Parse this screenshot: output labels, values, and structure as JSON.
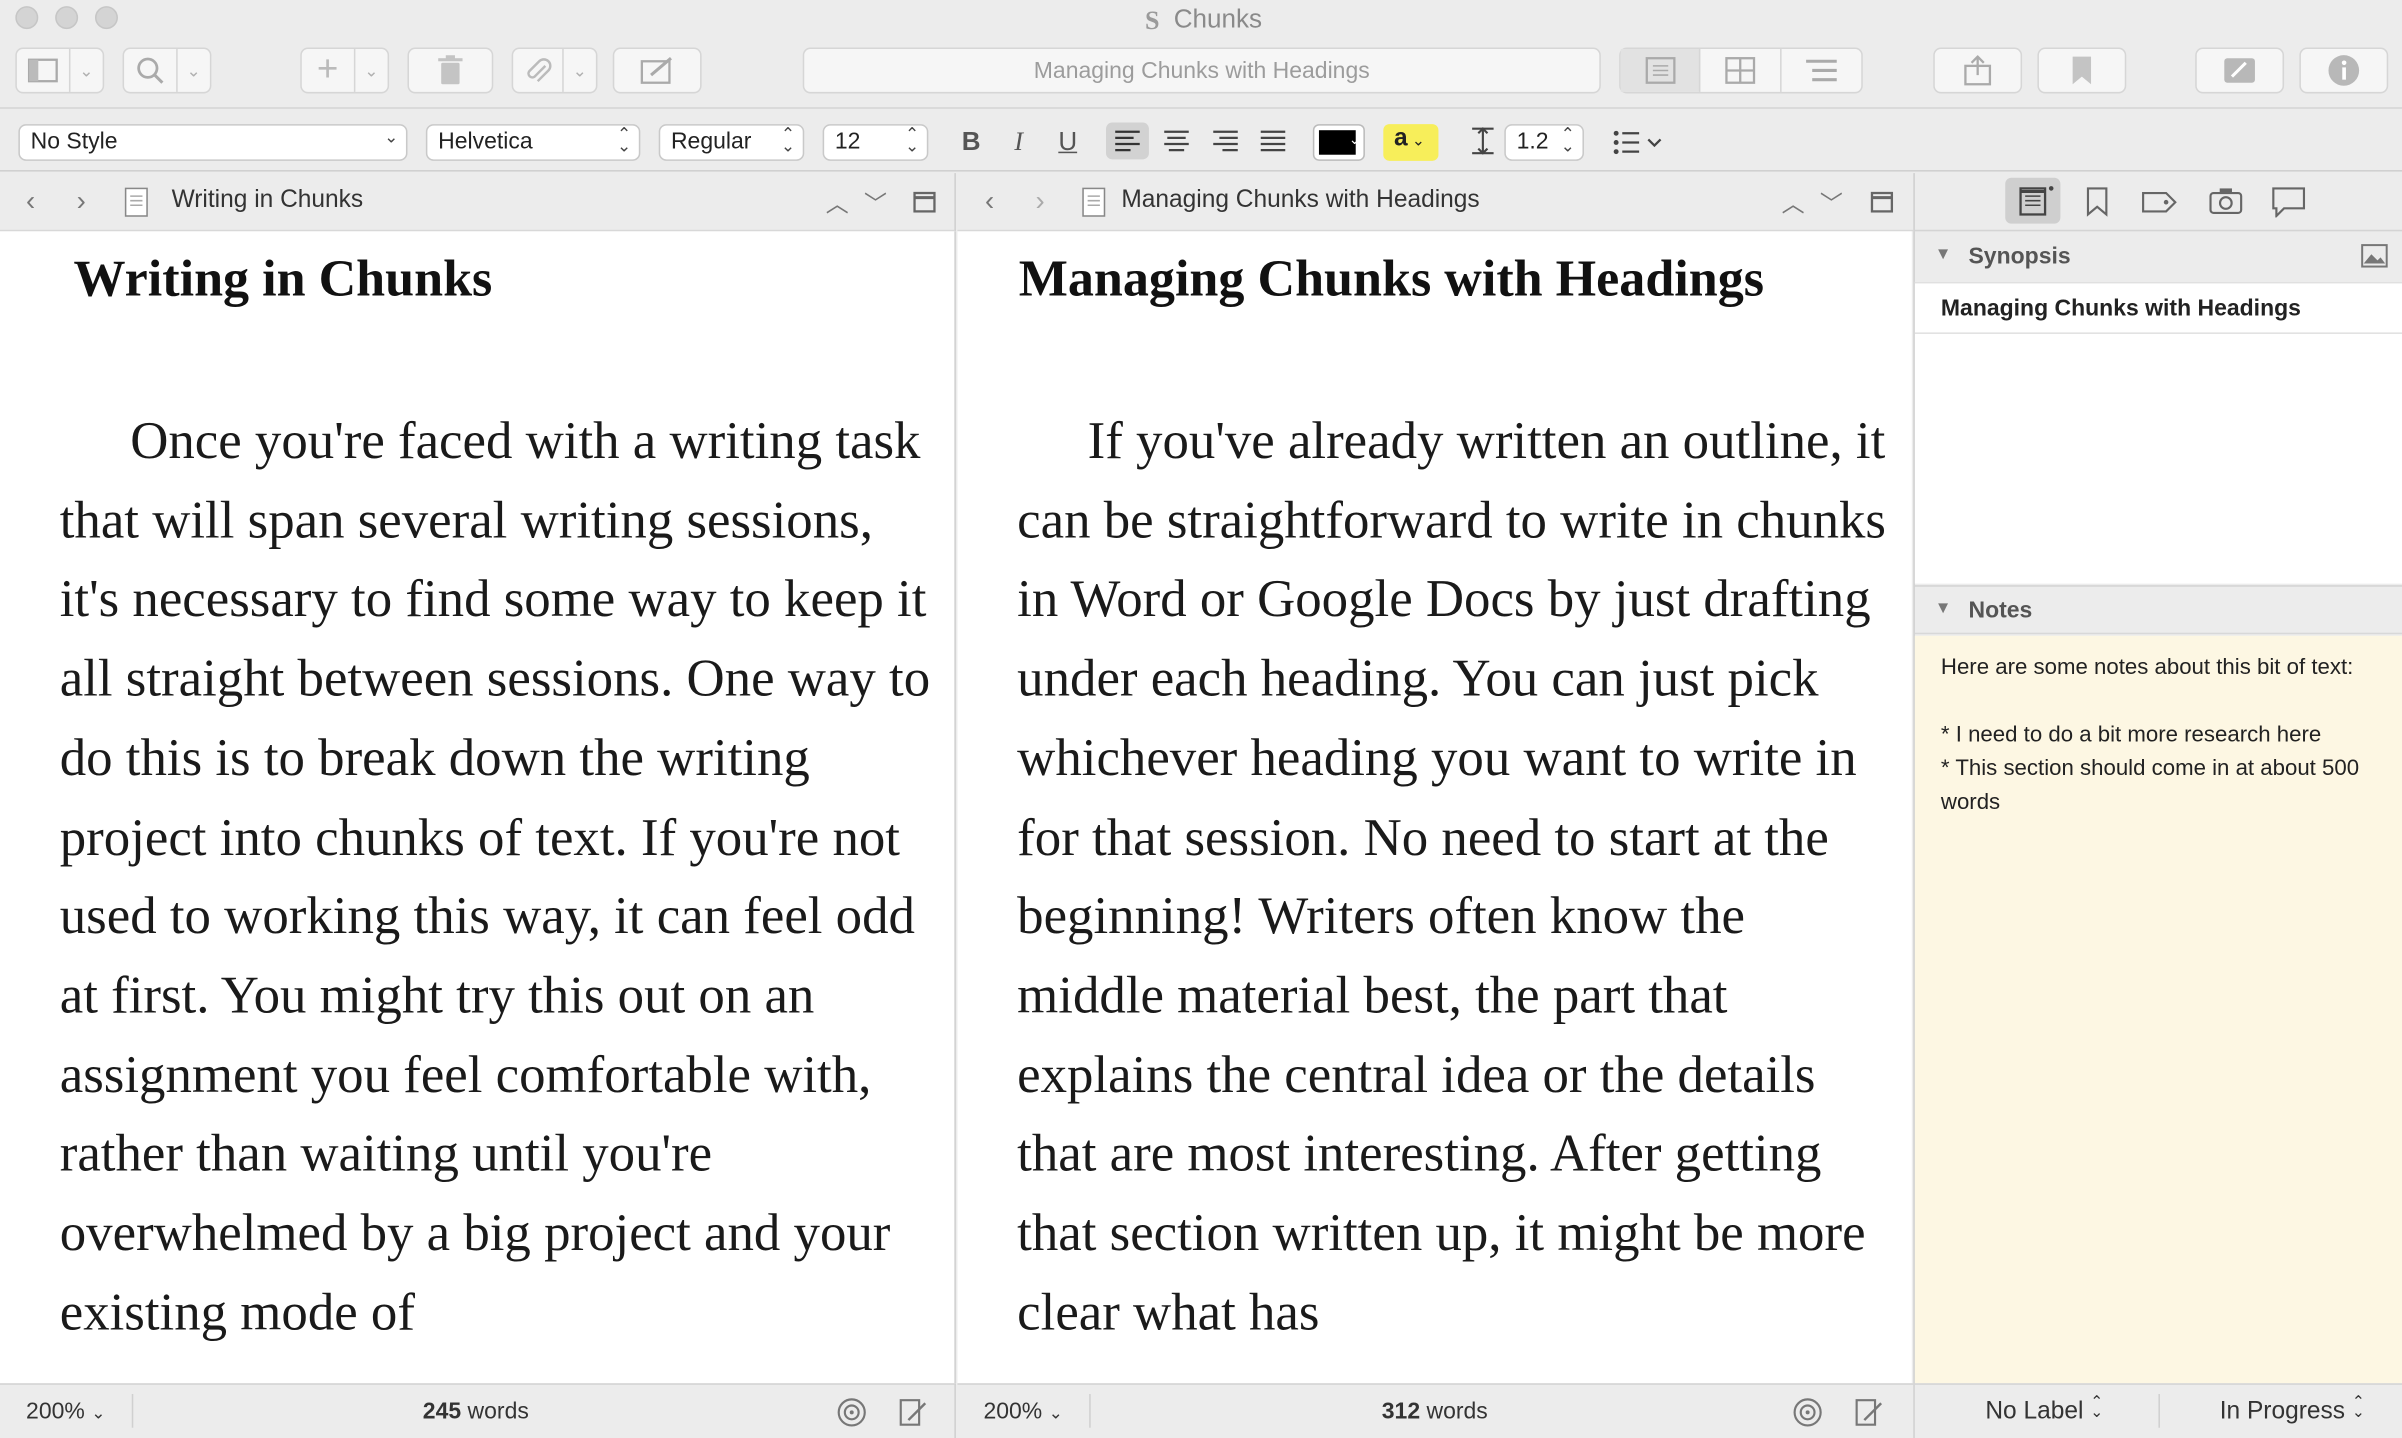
{
  "window": {
    "title": "Chunks"
  },
  "toolbar": {
    "document_title": "Managing Chunks with Headings"
  },
  "format_bar": {
    "paragraph_style": "No Style",
    "font_family": "Helvetica",
    "font_weight": "Regular",
    "font_size": "12",
    "bold": "B",
    "italic": "I",
    "underline": "U",
    "highlight_letter": "a",
    "line_spacing": "1.2",
    "text_color": "#000000",
    "highlight_color": "#f7ee5a"
  },
  "left_editor": {
    "header_title": "Writing in Chunks",
    "heading": "Writing in Chunks",
    "body": "Once you're faced with a writing task that will span several writing sessions, it's necessary to find some way to keep it all straight between sessions. One way to do this is to break down the writing project into chunks of text. If you're not used to working this way, it can feel odd at first. You might try this out on an assignment you feel comfortable with, rather than waiting until you're overwhelmed by a big project and your existing mode of",
    "zoom": "200%",
    "word_count": "245",
    "word_unit": "words"
  },
  "right_editor": {
    "header_title": "Managing Chunks with Headings",
    "heading": "Managing Chunks with Headings",
    "body": "If you've already written an outline, it can be straightforward to write in chunks in Word or Google Docs by just drafting under each heading. You can just pick whichever heading you want to write in for that session. No need to start at the beginning! Writers often know the middle material best, the part that explains the central idea or the details that are most interesting. After getting that section written up, it might be more clear what has",
    "zoom": "200%",
    "word_count": "312",
    "word_unit": "words"
  },
  "inspector": {
    "synopsis_label": "Synopsis",
    "synopsis_text": "Managing Chunks with Headings",
    "notes_label": "Notes",
    "notes_text": "Here are some notes about this bit of text:\n\n* I need to do a bit more research here\n* This section should come in at about 500 words",
    "notes_bg": "#fdf7e3",
    "label_value": "No Label",
    "status_value": "In Progress"
  }
}
